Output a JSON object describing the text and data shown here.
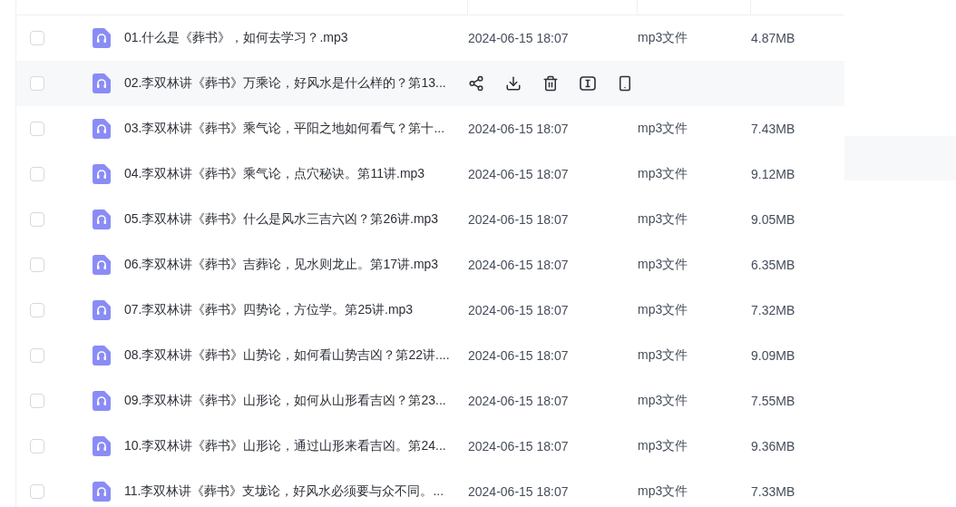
{
  "files": [
    {
      "name": "01.什么是《葬书》，如何去学习？.mp3",
      "modified": "2024-06-15 18:07",
      "type": "mp3文件",
      "size": "4.87MB",
      "checked": false,
      "hovered": false
    },
    {
      "name": "02.李双林讲《葬书》万乘论，好风水是什么样的？第13...",
      "checked": false,
      "hovered": true
    },
    {
      "name": "03.李双林讲《葬书》乘气论，平阳之地如何看气？第十...",
      "modified": "2024-06-15 18:07",
      "type": "mp3文件",
      "size": "7.43MB",
      "checked": false,
      "hovered": false
    },
    {
      "name": "04.李双林讲《葬书》乘气论，点穴秘诀。第11讲.mp3",
      "modified": "2024-06-15 18:07",
      "type": "mp3文件",
      "size": "9.12MB",
      "checked": false,
      "hovered": false
    },
    {
      "name": "05.李双林讲《葬书》什么是风水三吉六凶？第26讲.mp3",
      "modified": "2024-06-15 18:07",
      "type": "mp3文件",
      "size": "9.05MB",
      "checked": false,
      "hovered": false
    },
    {
      "name": "06.李双林讲《葬书》吉葬论，见水则龙止。第17讲.mp3",
      "modified": "2024-06-15 18:07",
      "type": "mp3文件",
      "size": "6.35MB",
      "checked": false,
      "hovered": false
    },
    {
      "name": "07.李双林讲《葬书》四势论，方位学。第25讲.mp3",
      "modified": "2024-06-15 18:07",
      "type": "mp3文件",
      "size": "7.32MB",
      "checked": false,
      "hovered": false
    },
    {
      "name": "08.李双林讲《葬书》山势论，如何看山势吉凶？第22讲....",
      "modified": "2024-06-15 18:07",
      "type": "mp3文件",
      "size": "9.09MB",
      "checked": false,
      "hovered": false
    },
    {
      "name": "09.李双林讲《葬书》山形论，如何从山形看吉凶？第23...",
      "modified": "2024-06-15 18:07",
      "type": "mp3文件",
      "size": "7.55MB",
      "checked": false,
      "hovered": false
    },
    {
      "name": "10.李双林讲《葬书》山形论，通过山形来看吉凶。第24...",
      "modified": "2024-06-15 18:07",
      "type": "mp3文件",
      "size": "9.36MB",
      "checked": false,
      "hovered": false
    },
    {
      "name": "11.李双林讲《葬书》支垅论，好风水必须要与众不同。...",
      "modified": "2024-06-15 18:07",
      "type": "mp3文件",
      "size": "7.33MB",
      "checked": false,
      "hovered": false
    }
  ]
}
